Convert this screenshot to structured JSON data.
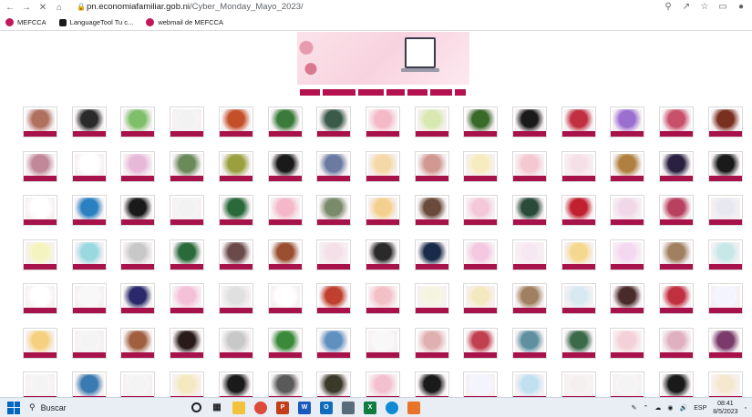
{
  "browser": {
    "url_domain": "pn.economiafamiliar.gob.ni",
    "url_path": "/Cyber_Monday_Mayo_2023/",
    "bookmarks": [
      {
        "label": "MEFCCA"
      },
      {
        "label": "LanguageTool Tu c..."
      },
      {
        "label": "webmail de MEFCCA"
      }
    ]
  },
  "colors": {
    "accent": "#a8124a",
    "banner": "#f8d3df"
  },
  "taskbar": {
    "search_placeholder": "Buscar",
    "lang": "ESP",
    "time": "08:41",
    "date": "8/5/2023"
  },
  "tiles": [
    [
      "#b07060",
      "#2a2a2a",
      "#7fbf6a",
      "#f2f2f2",
      "#c4502a",
      "#3a7a3a",
      "#3a5a4a",
      "#f4b8c8",
      "#d8e8b0",
      "#3a6a2a",
      "#1a1a1a",
      "#c03040",
      "#9b6fd0",
      "#c8506a",
      "#7a3020"
    ],
    [
      "#c08898",
      "#ffffff",
      "#e8b8d8",
      "#6a8a5a",
      "#9aa040",
      "#1a1a1a",
      "#6a7aa0",
      "#f4d8a8",
      "#d09890",
      "#f6ecc0",
      "#f4c8d0",
      "#f6e0e8",
      "#b08040",
      "#2a2040",
      "#1a1a1a"
    ],
    [
      "#ffffff",
      "#2a80c0",
      "#1a1a1a",
      "#f2f2f2",
      "#2a6a3a",
      "#f4b8c8",
      "#7a8a6a",
      "#f4d090",
      "#6a4a3a",
      "#f4c8d8",
      "#2a4a3a",
      "#c02030",
      "#f0d8e8",
      "#b84060",
      "#e8e8f0"
    ],
    [
      "#f4f4c0",
      "#9ad8e0",
      "#c8c8c8",
      "#2a6a3a",
      "#6a4a4a",
      "#9a5030",
      "#f4e0e8",
      "#2a2a2a",
      "#1a2a4a",
      "#f4c8e0",
      "#f6e8f0",
      "#f4d890",
      "#f4d8f0",
      "#a08060",
      "#c8e8e8"
    ],
    [
      "#ffffff",
      "#f8f8f8",
      "#2a2a6a",
      "#f4c0d8",
      "#e0e0e0",
      "#ffffff",
      "#c04030",
      "#f4c0c8",
      "#f4f4e0",
      "#f4e8c0",
      "#a08060",
      "#d8e8f0",
      "#4a2a2a",
      "#c03040",
      "#f4f4ff"
    ],
    [
      "#f4d080",
      "#f4f4f4",
      "#a06040",
      "#2a1a1a",
      "#c8c8c8",
      "#3a8a3a",
      "#6090c0",
      "#f8f8f8",
      "#e0b0b0",
      "#c04050",
      "#6090a0",
      "#3a6a4a",
      "#f4d0d8",
      "#e0b0c0",
      "#7a3a6a"
    ],
    [
      "#f4f4f4",
      "#3a7ab0",
      "#f4f4f4",
      "#f4e8c0",
      "#1a1a1a",
      "#5a5a5a",
      "#3a3a2a",
      "#f4c0d0",
      "#1a1a1a",
      "#f4f4ff",
      "#c0e0f0",
      "#f4f0f0",
      "#f4f4f4",
      "#1a1a1a",
      "#f4e8d0"
    ]
  ]
}
